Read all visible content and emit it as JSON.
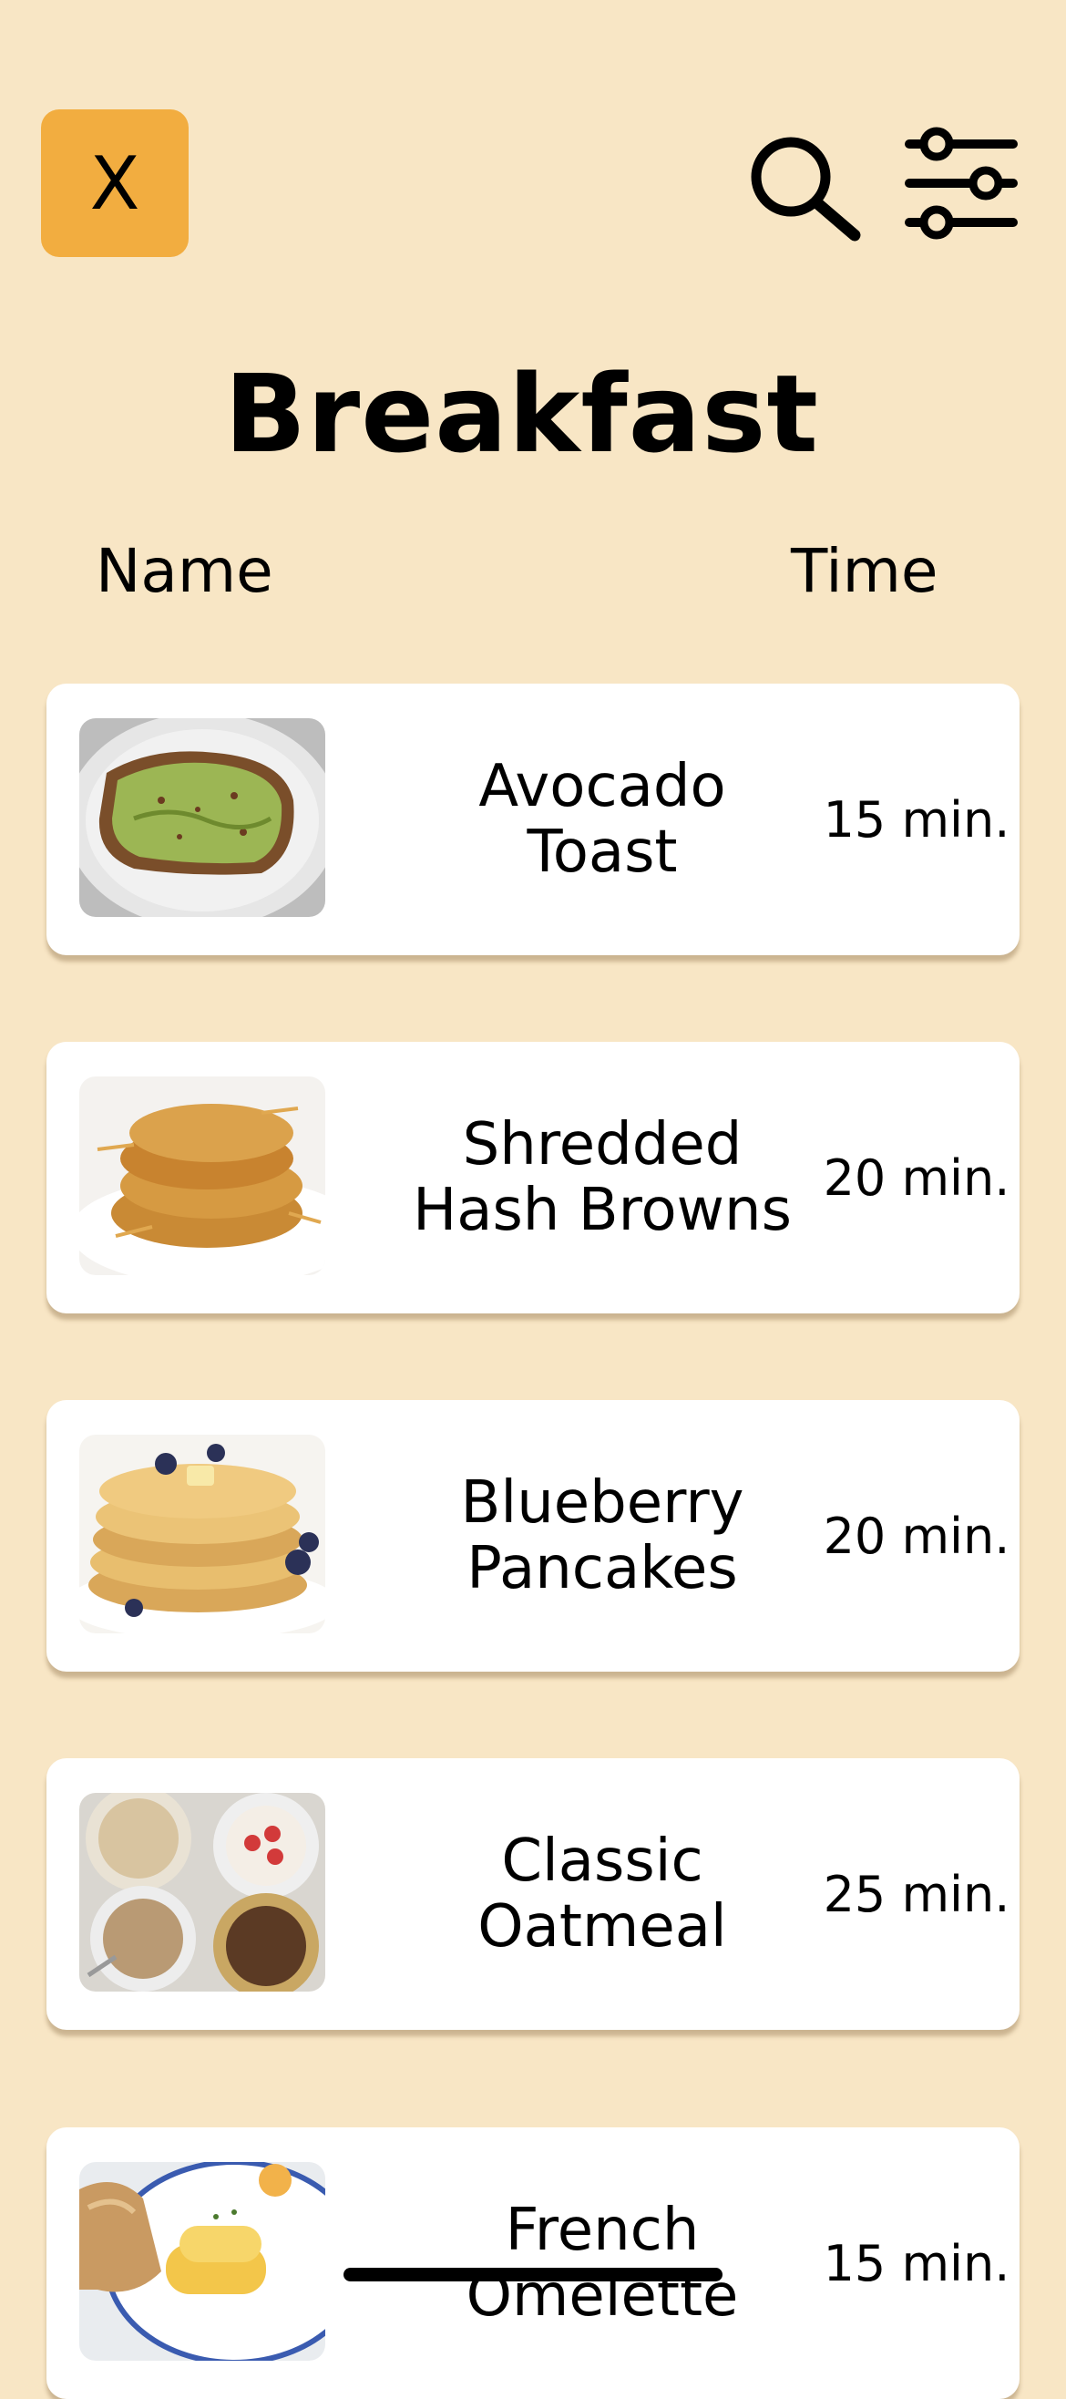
{
  "header": {
    "close_label": "X",
    "search_icon": "search-icon",
    "filter_icon": "sliders-icon"
  },
  "page": {
    "title": "Breakfast"
  },
  "columns": {
    "name": "Name",
    "time": "Time"
  },
  "recipes": [
    {
      "name": "Avocado\nToast",
      "time": "15 min.",
      "image": "avocado-toast-image"
    },
    {
      "name": "Shredded\nHash Browns",
      "time": "20 min.",
      "image": "hash-browns-image"
    },
    {
      "name": "Blueberry\nPancakes",
      "time": "20 min.",
      "image": "pancakes-image"
    },
    {
      "name": "Classic\nOatmeal",
      "time": "25 min.",
      "image": "oatmeal-image"
    },
    {
      "name": "French\nOmelette",
      "time": "15 min.",
      "image": "omelette-image"
    }
  ],
  "colors": {
    "background": "#F8E6C5",
    "accent": "#F2AD40",
    "card": "#FFFFFF"
  }
}
